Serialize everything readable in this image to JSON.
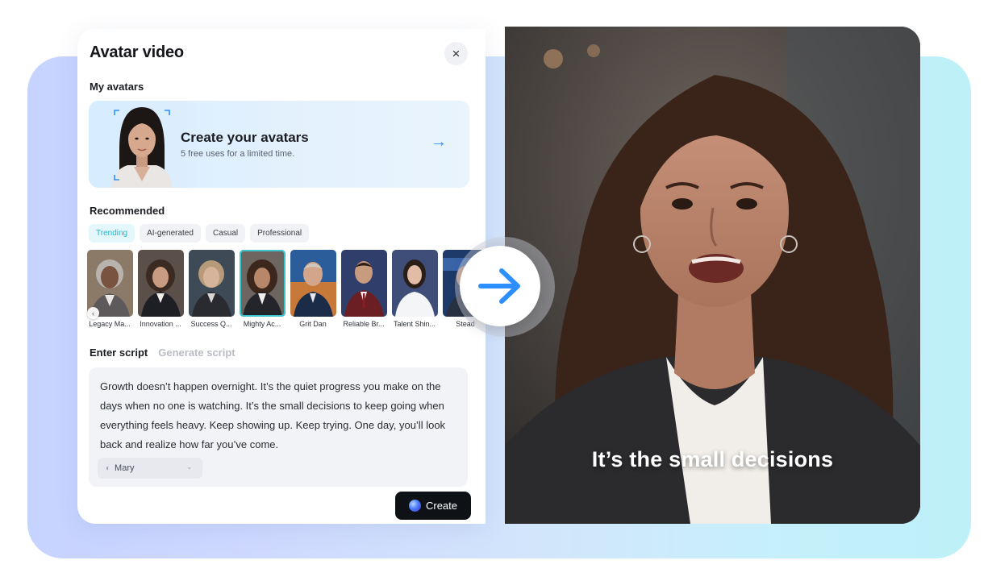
{
  "panel": {
    "title": "Avatar video",
    "close_icon": "×",
    "my_avatars_label": "My avatars",
    "create_card": {
      "title": "Create your avatars",
      "subtitle": "5 free uses for a limited time.",
      "arrow_icon": "→"
    },
    "recommended_label": "Recommended",
    "chips": [
      {
        "label": "Trending",
        "active": true
      },
      {
        "label": "AI-generated",
        "active": false
      },
      {
        "label": "Casual",
        "active": false
      },
      {
        "label": "Professional",
        "active": false
      }
    ],
    "avatars": [
      {
        "name": "Legacy Ma..."
      },
      {
        "name": "Innovation ..."
      },
      {
        "name": "Success Q..."
      },
      {
        "name": "Mighty Ac...",
        "selected": true
      },
      {
        "name": "Grit Dan"
      },
      {
        "name": "Reliable Br..."
      },
      {
        "name": "Talent Shin..."
      },
      {
        "name": "Stead"
      }
    ],
    "tabs": {
      "enter_script": "Enter script",
      "generate_script": "Generate script"
    },
    "script_text": "Growth doesn’t happen overnight. It’s the quiet progress you make on the days when no one is watching. It’s the small decisions to keep going when everything feels heavy. Keep showing up. Keep trying. One day, you’ll look back and realize how far you’ve come.",
    "voice": {
      "name": "Mary"
    },
    "create_button": "Create"
  },
  "video": {
    "caption": "It’s the small decisions"
  },
  "colors": {
    "accent": "#2d8fff",
    "chip_active": "#26b4cc",
    "button_dark": "#0e1217"
  }
}
